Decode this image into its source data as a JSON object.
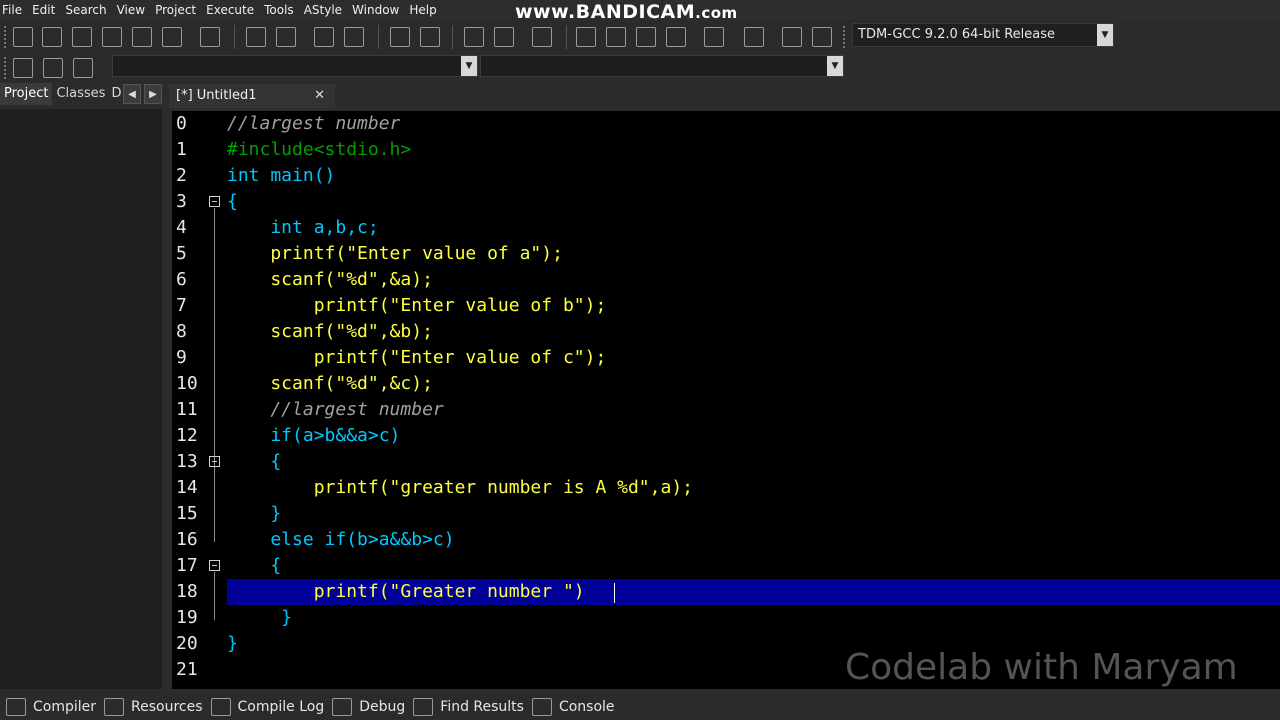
{
  "menu": [
    "File",
    "Edit",
    "Search",
    "View",
    "Project",
    "Execute",
    "Tools",
    "AStyle",
    "Window",
    "Help"
  ],
  "watermark_top": {
    "main": "www.BANDICAM",
    "suffix": ".com"
  },
  "compiler_select": "TDM-GCC 9.2.0 64-bit Release",
  "left_tabs": [
    "Project",
    "Classes",
    "D"
  ],
  "editor_tab": {
    "label": "[*] Untitled1",
    "close": "✕"
  },
  "code_lines": [
    {
      "n": "0",
      "text": "//largest number"
    },
    {
      "n": "1",
      "text": "#include<stdio.h>"
    },
    {
      "n": "2",
      "text": "int main()"
    },
    {
      "n": "3",
      "text": "{"
    },
    {
      "n": "4",
      "text": "    int a,b,c;"
    },
    {
      "n": "5",
      "text": "    printf(\"Enter value of a\");"
    },
    {
      "n": "6",
      "text": "    scanf(\"%d\",&a);"
    },
    {
      "n": "7",
      "text": "        printf(\"Enter value of b\");"
    },
    {
      "n": "8",
      "text": "    scanf(\"%d\",&b);"
    },
    {
      "n": "9",
      "text": "        printf(\"Enter value of c\");"
    },
    {
      "n": "10",
      "text": "    scanf(\"%d\",&c);"
    },
    {
      "n": "11",
      "text": "    //largest number"
    },
    {
      "n": "12",
      "text": "    if(a>b&&a>c)"
    },
    {
      "n": "13",
      "text": "    {"
    },
    {
      "n": "14",
      "text": "        printf(\"greater number is A %d\",a);"
    },
    {
      "n": "15",
      "text": "    }"
    },
    {
      "n": "16",
      "text": "    else if(b>a&&b>c)"
    },
    {
      "n": "17",
      "text": "    {"
    },
    {
      "n": "18",
      "text": "        printf(\"Greater number \")"
    },
    {
      "n": "19",
      "text": "     }"
    },
    {
      "n": "20",
      "text": "}"
    },
    {
      "n": "21",
      "text": ""
    }
  ],
  "watermark_br": "Codelab with Maryam",
  "bottom_tabs": [
    "Compiler",
    "Resources",
    "Compile Log",
    "Debug",
    "Find Results",
    "Console"
  ],
  "colors": {
    "background": "#000000",
    "highlight": "#000096",
    "keyword": "#00c8ff",
    "string": "#ffff40",
    "preprocessor": "#00a000",
    "comment": "#a0a0a0"
  }
}
